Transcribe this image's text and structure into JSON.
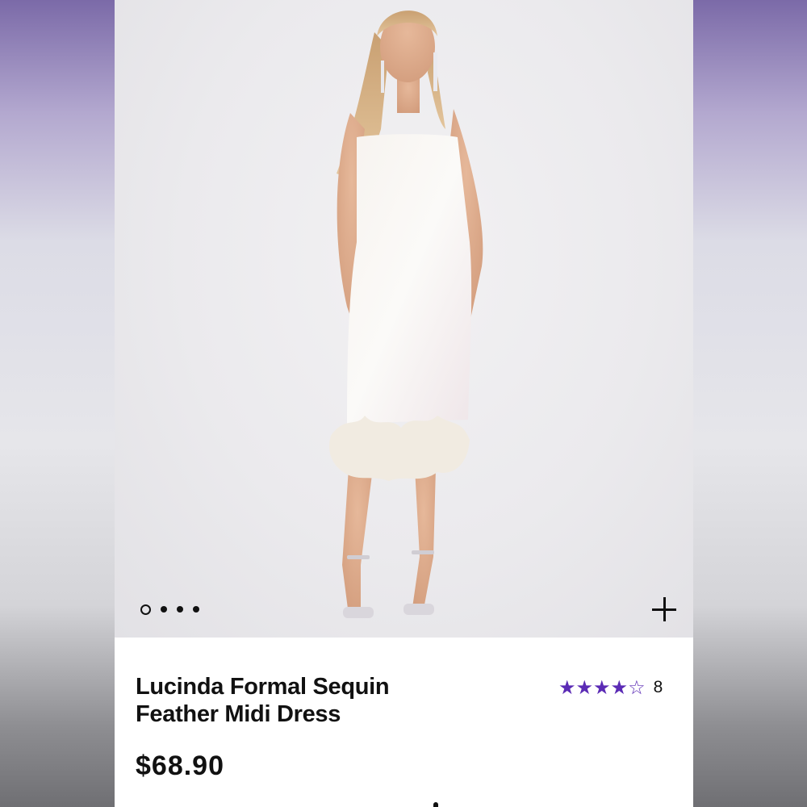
{
  "product": {
    "title_line1": "Lucinda Formal Sequin",
    "title_line2": "Feather Midi Dress",
    "price": "$68.90",
    "rating": {
      "value": 4,
      "max": 5,
      "count": "8"
    }
  },
  "gallery": {
    "image_count": 4,
    "active_index": 0,
    "zoom_icon": "plus-icon"
  },
  "colors": {
    "star": "#5b2bb5",
    "text": "#111111",
    "background_top": "#7b6aa8"
  }
}
